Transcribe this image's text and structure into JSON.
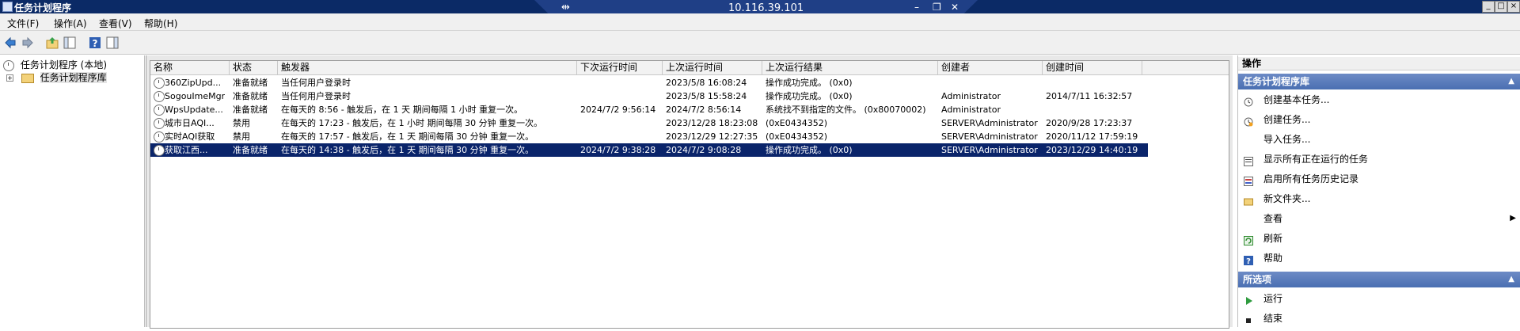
{
  "window": {
    "title": "任务计划程序",
    "remote_address": "10.116.39.101"
  },
  "menu": {
    "items": [
      "文件(F)",
      "操作(A)",
      "查看(V)",
      "帮助(H)"
    ]
  },
  "tree": {
    "root_label": "任务计划程序 (本地)",
    "library_label": "任务计划程序库"
  },
  "table": {
    "columns": [
      "名称",
      "状态",
      "触发器",
      "下次运行时间",
      "上次运行时间",
      "上次运行结果",
      "创建者",
      "创建时间"
    ],
    "rows": [
      {
        "name": "360ZipUpd...",
        "status": "准备就绪",
        "trigger": "当任何用户登录时",
        "next_run": "",
        "last_run": "2023/5/8 16:08:24",
        "last_result": "操作成功完成。 (0x0)",
        "author": "",
        "created": ""
      },
      {
        "name": "SogouImeMgr",
        "status": "准备就绪",
        "trigger": "当任何用户登录时",
        "next_run": "",
        "last_run": "2023/5/8 15:58:24",
        "last_result": "操作成功完成。 (0x0)",
        "author": "Administrator",
        "created": "2014/7/11 16:32:57"
      },
      {
        "name": "WpsUpdate...",
        "status": "准备就绪",
        "trigger": "在每天的 8:56 - 触发后，在 1 天 期间每隔 1 小时 重复一次。",
        "next_run": "2024/7/2 9:56:14",
        "last_run": "2024/7/2 8:56:14",
        "last_result": "系统找不到指定的文件。 (0x80070002)",
        "author": "Administrator",
        "created": ""
      },
      {
        "name": "城市日AQI...",
        "status": "禁用",
        "trigger": "在每天的 17:23 - 触发后，在 1 小时 期间每隔 30 分钟 重复一次。",
        "next_run": "",
        "last_run": "2023/12/28 18:23:08",
        "last_result": "(0xE0434352)",
        "author": "SERVER\\Administrator",
        "created": "2020/9/28 17:23:37"
      },
      {
        "name": "实时AQI获取",
        "status": "禁用",
        "trigger": "在每天的 17:57 - 触发后，在 1 天 期间每隔 30 分钟 重复一次。",
        "next_run": "",
        "last_run": "2023/12/29 12:27:35",
        "last_result": "(0xE0434352)",
        "author": "SERVER\\Administrator",
        "created": "2020/11/12 17:59:19"
      },
      {
        "name": "获取江西...",
        "status": "准备就绪",
        "trigger": "在每天的 14:38 - 触发后，在 1 天 期间每隔 30 分钟 重复一次。",
        "next_run": "2024/7/2 9:38:28",
        "last_run": "2024/7/2 9:08:28",
        "last_result": "操作成功完成。 (0x0)",
        "author": "SERVER\\Administrator",
        "created": "2023/12/29 14:40:19"
      }
    ],
    "selected_row": 5
  },
  "actions": {
    "title": "操作",
    "library_section": "任务计划程序库",
    "library_items": [
      {
        "label": "创建基本任务...",
        "icon": "create-basic-task-icon"
      },
      {
        "label": "创建任务...",
        "icon": "create-task-icon"
      },
      {
        "label": "导入任务...",
        "icon": ""
      },
      {
        "label": "显示所有正在运行的任务",
        "icon": "running-tasks-icon"
      },
      {
        "label": "启用所有任务历史记录",
        "icon": "history-icon"
      },
      {
        "label": "新文件夹...",
        "icon": "folder-icon"
      },
      {
        "label": "查看",
        "icon": "",
        "submenu": true
      },
      {
        "label": "刷新",
        "icon": "refresh-icon"
      },
      {
        "label": "帮助",
        "icon": "help-icon"
      }
    ],
    "selected_section": "所选项",
    "selected_items": [
      {
        "label": "运行",
        "icon": "run-icon"
      },
      {
        "label": "结束",
        "icon": "end-icon"
      }
    ]
  },
  "colors": {
    "titlebar": "#0b2a66",
    "selection": "#0a246a",
    "section_header": "#4a6fb2"
  }
}
